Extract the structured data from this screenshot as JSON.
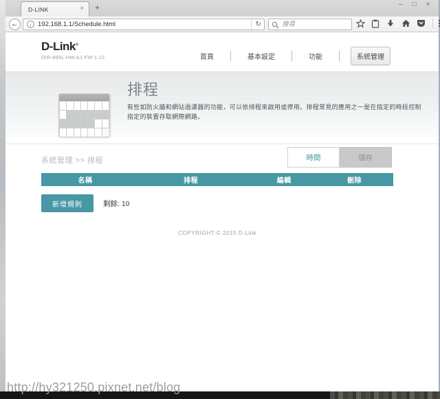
{
  "colors": {
    "accent_teal": "#4797a4"
  },
  "browser": {
    "tab": {
      "title": "D-LINK",
      "close_glyph": "×",
      "new_tab_glyph": "+"
    },
    "window_controls": {
      "minimize": "–",
      "maximize": "□",
      "close": "×"
    },
    "back_glyph": "←",
    "reload_glyph": "↻",
    "info_glyph": "i",
    "url": "192.168.1.1/Schedule.html",
    "search_placeholder": "搜尋"
  },
  "site": {
    "logo": "D-Link",
    "logo_reg": "®",
    "device": "DIR-895L HW:A1 FW:1.12",
    "nav": [
      {
        "label": "首頁"
      },
      {
        "label": "基本設定"
      },
      {
        "label": "功能"
      },
      {
        "label": "系統管理"
      }
    ],
    "banner": {
      "title": "排程",
      "desc_line1": "有些如防火牆和網站過濾器的功能，可以依排程來啟用或停用。排程常見的應用之一是在指定的時段控制",
      "desc_line2": "指定的裝置存取網際網路。"
    },
    "breadcrumb": "系統管理 >> 排程",
    "mode_tabs": {
      "time": "時間",
      "save": "儲存"
    },
    "table": {
      "headers": [
        "名稱",
        "排程",
        "編輯",
        "刪除"
      ]
    },
    "add_rule_label": "新增規則",
    "remaining_text": "剩餘: 10",
    "copyright": "COPYRIGHT © 2015 D-Link"
  },
  "watermark": "http://hy321250.pixnet.net/blog"
}
